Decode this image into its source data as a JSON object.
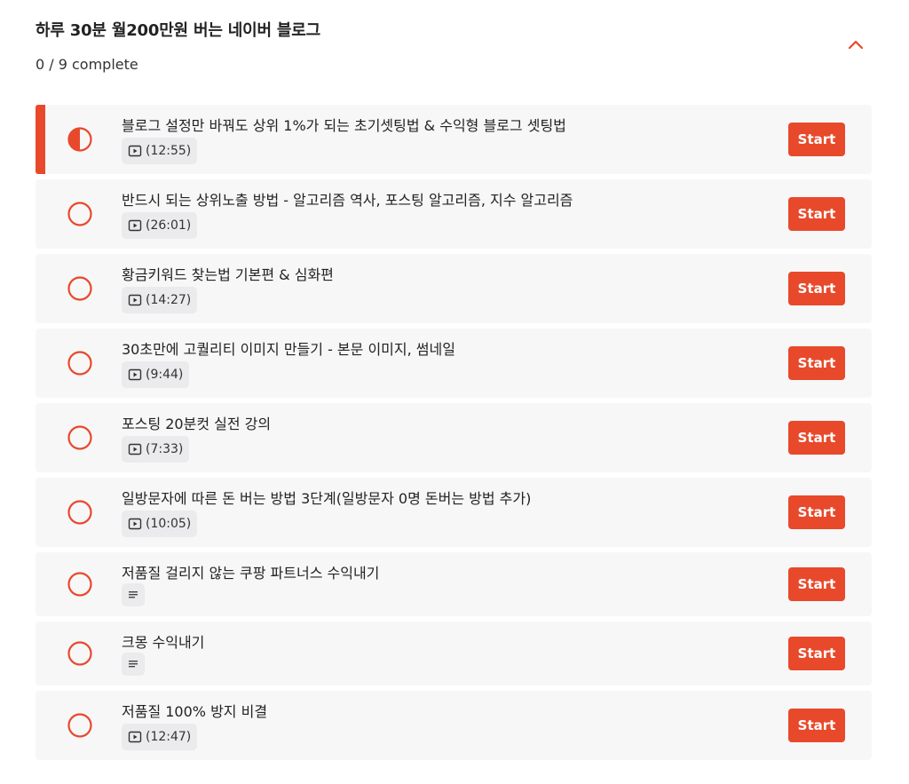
{
  "section": {
    "title": "하루 30분 월200만원 버는 네이버 블로그",
    "progress": "0 / 9 complete",
    "toggle_icon": "chevron-up-icon"
  },
  "colors": {
    "accent": "#e8492b",
    "row_bg": "#f7f7f8",
    "chip_bg": "#ebebed"
  },
  "lessons": [
    {
      "title": "블로그 설정만 바꿔도 상위 1%가 되는 초기셋팅법 & 수익형 블로그 셋팅법",
      "type": "video",
      "duration": "(12:55)",
      "status": "in-progress",
      "button": "Start"
    },
    {
      "title": "반드시 되는 상위노출 방법 - 알고리즘 역사, 포스팅 알고리즘, 지수 알고리즘",
      "type": "video",
      "duration": "(26:01)",
      "status": "not-started",
      "button": "Start"
    },
    {
      "title": "황금키워드 찾는법 기본편 & 심화편",
      "type": "video",
      "duration": "(14:27)",
      "status": "not-started",
      "button": "Start"
    },
    {
      "title": "30초만에 고퀄리티 이미지 만들기 - 본문 이미지, 썸네일",
      "type": "video",
      "duration": "(9:44)",
      "status": "not-started",
      "button": "Start"
    },
    {
      "title": "포스팅 20분컷 실전 강의",
      "type": "video",
      "duration": "(7:33)",
      "status": "not-started",
      "button": "Start"
    },
    {
      "title": "일방문자에 따른 돈 버는 방법 3단계(일방문자 0명 돈버는 방법 추가)",
      "type": "video",
      "duration": "(10:05)",
      "status": "not-started",
      "button": "Start"
    },
    {
      "title": "저품질 걸리지 않는 쿠팡 파트너스 수익내기",
      "type": "text",
      "duration": "",
      "status": "not-started",
      "button": "Start"
    },
    {
      "title": "크몽 수익내기",
      "type": "text",
      "duration": "",
      "status": "not-started",
      "button": "Start"
    },
    {
      "title": "저품질 100% 방지 비결",
      "type": "video",
      "duration": "(12:47)",
      "status": "not-started",
      "button": "Start"
    }
  ]
}
